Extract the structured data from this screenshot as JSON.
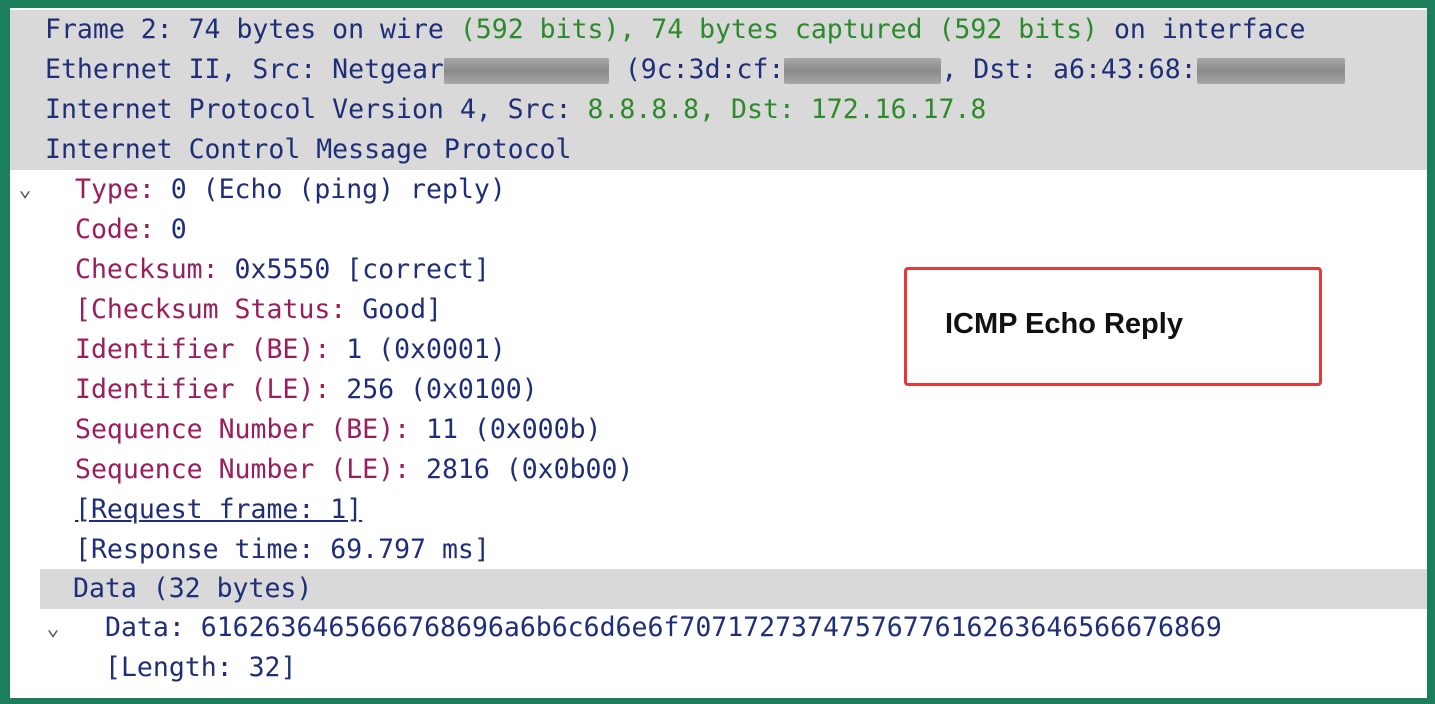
{
  "tree": {
    "frame": {
      "arrow": "›",
      "label": "Frame 2: 74 bytes on wire ",
      "highlight": "(592 bits), 74 bytes captured (592 bits)",
      "tail": " on interface"
    },
    "ethernet": {
      "arrow": "›",
      "label": "Ethernet II, Src: Netgear",
      "mac_prefix": " (9c:3d:cf:",
      "dst_label": ", Dst: a6:43:68:"
    },
    "ip": {
      "arrow": "›",
      "label": "Internet Protocol Version 4, Src: ",
      "addresses": "8.8.8.8, Dst: 172.16.17.8"
    },
    "icmp": {
      "arrow": "⌄",
      "label": "Internet Control Message Protocol",
      "fields": {
        "type_name": "Type: ",
        "type_value": "0 (Echo (ping) reply)",
        "code_name": "Code: ",
        "code_value": "0",
        "checksum_name": "Checksum: ",
        "checksum_value": "0x5550 [correct]",
        "checksum_status_open": "[",
        "checksum_status_name": "Checksum Status: ",
        "checksum_status_value": "Good]",
        "id_be_name": "Identifier (BE): ",
        "id_be_value": "1 (0x0001)",
        "id_le_name": "Identifier (LE): ",
        "id_le_value": "256 (0x0100)",
        "seq_be_name": "Sequence Number (BE): ",
        "seq_be_value": "11 (0x000b)",
        "seq_le_name": "Sequence Number (LE): ",
        "seq_le_value": "2816 (0x0b00)",
        "request_frame": "[Request frame: 1]",
        "response_time": "[Response time: 69.797 ms]"
      },
      "data": {
        "arrow": "⌄",
        "label": "Data (32 bytes)",
        "payload_name": "Data: ",
        "payload_value": "6162636465666768696a6b6c6d6e6f7071727374757677616263646566676869",
        "length": "[Length: 32]"
      }
    }
  },
  "callout": {
    "label": "ICMP Echo Reply"
  },
  "colors": {
    "border": "#1a7f5a",
    "header_shade": "#d9d9d9",
    "field_name": "#9a1e5c",
    "value": "#1f2e78",
    "address": "#2c8a2c",
    "callout_border": "#e53935"
  }
}
